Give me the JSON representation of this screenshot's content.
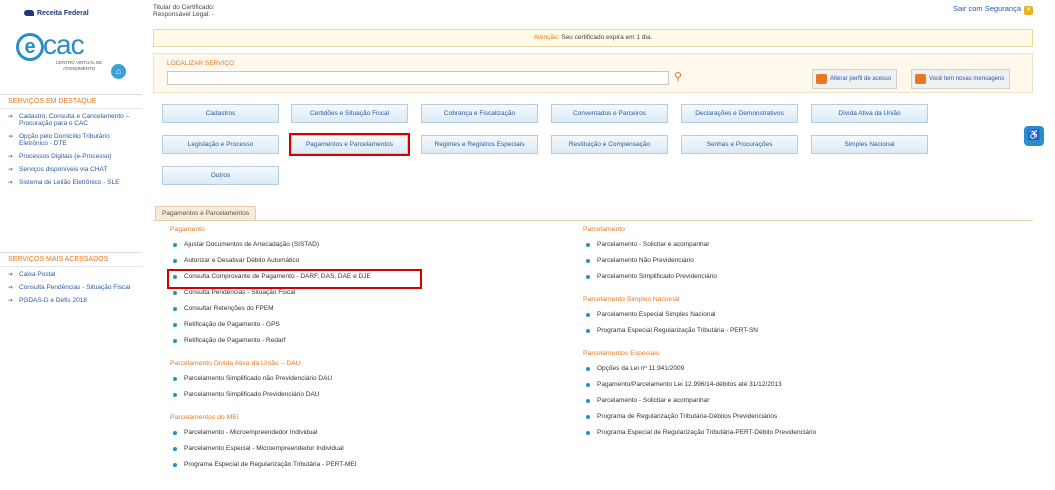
{
  "header": {
    "logo_text": "Receita Federal",
    "ecac_logo": "ecac",
    "ecac_sub": "CENTRO VIRTUAL DE ATENDIMENTO",
    "cert_holder": "Titular do Certificado:",
    "cert_responsible": "Responsável Legal: -",
    "logout": "Sair com Segurança"
  },
  "alert": {
    "warning": "Atenção:",
    "message": "Seu certificado expira em 1 dia."
  },
  "search": {
    "label": "LOCALIZAR SERVIÇO",
    "value": "",
    "btn_profile": "Alterar perfil de acesso",
    "btn_messages": "Você tem novas mensagens"
  },
  "sidebar": {
    "featured_title": "SERVIÇOS EM DESTAQUE",
    "featured_items": [
      "Cadastro, Consulta e Cancelamento – Procuração para o CAC",
      "Opção pelo Domicílio Tributário Eletrônico - DTE",
      "Processos Digitais (e-Processo)",
      "Serviços disponíveis via CHAT",
      "Sistema de Leilão Eletrônico - SLE"
    ],
    "most_title": "SERVIÇOS MAIS ACESSADOS",
    "most_items": [
      "Caixa Postal",
      "Consulta Pendências - Situação Fiscal",
      "PGDAS-D e Defis 2018"
    ]
  },
  "menu": [
    "Cadastros",
    "Certidões e Situação Fiscal",
    "Cobrança e Fiscalização",
    "Conventados e Parceiros",
    "Declarações e Demonstrativos",
    "Dívida Ativa da União",
    "Legislação e Processo",
    "Pagamentos e Parcelamentos",
    "Regimes e Registros Especiais",
    "Restituição e Compensação",
    "Senhas e Procurações",
    "Simples Nacional",
    "Outros"
  ],
  "panel": {
    "tab": "Pagamentos e Parcelamentos",
    "left": [
      {
        "title": "Pagamento",
        "items": [
          "Ajustar Documentos de Arrecadação (SISTAD)",
          "Autorizar e Desativar Débito Automático",
          "Consulta Comprovante de Pagamento - DARF, DAS, DAE e DJE",
          "Consulta Pendências - Situação Fiscal",
          "Consultar Retenções do FPEM",
          "Retificação de Pagamento - GPS",
          "Retificação de Pagamento - Redarf"
        ]
      },
      {
        "title": "Parcelamento Dívida Ativa da União – DAU",
        "items": [
          "Parcelamento Simplificado não Previdenciário DAU",
          "Parcelamento Simplificado Previdenciário DAU"
        ]
      },
      {
        "title": "Parcelamentos do MEI",
        "items": [
          "Parcelamento - Microempreendedor Individual",
          "Parcelamento Especial - Microempreendedor Individual",
          "Programa Especial de Regularização Tributária - PERT-MEI"
        ]
      }
    ],
    "right": [
      {
        "title": "Parcelamento",
        "items": [
          "Parcelamento - Solicitar e acompanhar",
          "Parcelamento Não Previdenciário",
          "Parcelamento Simplificado Previdenciário"
        ]
      },
      {
        "title": "Parcelamento Simples Nacional",
        "items": [
          "Parcelamento Especial Simples Nacional",
          "Programa Especial Regularização Tributária - PERT-SN"
        ]
      },
      {
        "title": "Parcelamentos Especiais",
        "items": [
          "Opções da Lei nº 11.941/2009",
          "Pagamento/Parcelamento Lei 12.996/14-débitos até 31/12/2013",
          "Parcelamento - Solicitar e acompanhar",
          "Programa de Regularização Tributária-Débitos Previdenciários",
          "Programa Especial de Regularização Tributária-PERT-Débito Previdenciário"
        ]
      }
    ]
  },
  "icons": {
    "home": "home-icon",
    "search": "search-icon",
    "accessibility": "accessibility-icon"
  }
}
